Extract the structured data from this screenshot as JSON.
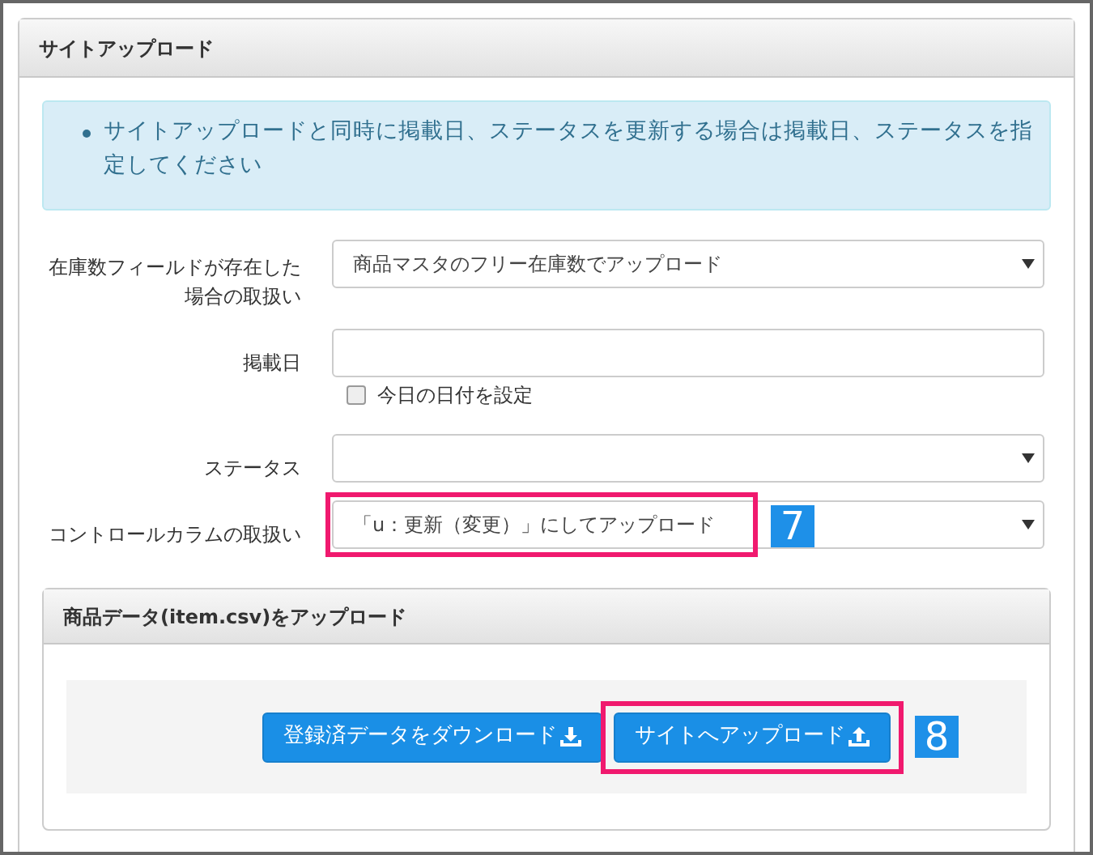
{
  "panel": {
    "title": "サイトアップロード"
  },
  "notice": {
    "items": [
      "サイトアップロードと同時に掲載日、ステータスを更新する場合は掲載日、ステータスを指定してください"
    ]
  },
  "form": {
    "rows": [
      {
        "kind": "select",
        "label": "在庫数フィールドが存在した場合の取扱い",
        "value": "商品マスタのフリー在庫数でアップロード"
      },
      {
        "kind": "date",
        "label": "掲載日",
        "checkbox": {
          "label": "今日の日付を設定",
          "checked": false
        }
      },
      {
        "kind": "select",
        "label": "ステータス"
      },
      {
        "kind": "select",
        "label": "コントロールカラムの取扱い",
        "value": "「u：更新（変更）」にしてアップロード",
        "callout": "7"
      }
    ]
  },
  "upload_panel": {
    "title": "商品データ(item.csv)をアップロード",
    "buttons": [
      {
        "label": "登録済データをダウンロード",
        "kind": "download"
      },
      {
        "label": "サイトへアップロード",
        "kind": "upload",
        "callout": "8"
      }
    ]
  }
}
